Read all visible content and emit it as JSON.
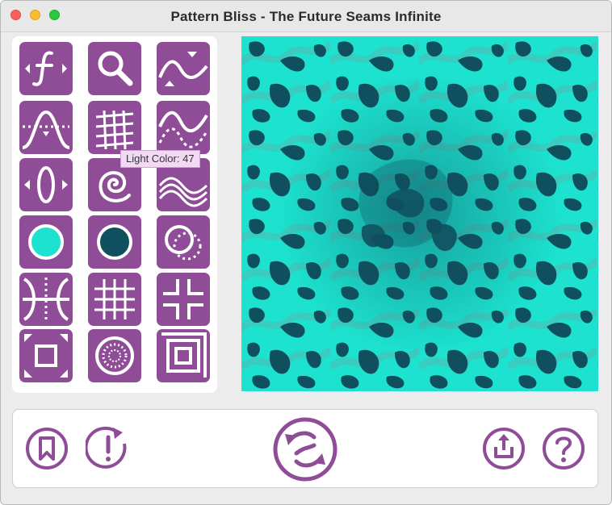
{
  "window": {
    "title": "Pattern Bliss - The Future Seams Infinite"
  },
  "tooltip": {
    "text": "Light Color: 47"
  },
  "colors": {
    "tool_background": "#8f4d98",
    "tool_foreground": "#ffffff",
    "light_color": "#1de2cf",
    "dark_color": "#0f4f5e",
    "tooltip_background": "#f3d9f4"
  },
  "tools": [
    {
      "icon": "function-icon"
    },
    {
      "icon": "magnifier-icon"
    },
    {
      "icon": "wave-arrows-icon"
    },
    {
      "icon": "bell-curve-icon"
    },
    {
      "icon": "grid-distort-icon"
    },
    {
      "icon": "wave-dashed-icon"
    },
    {
      "icon": "lens-arrows-icon"
    },
    {
      "icon": "spiral-icon"
    },
    {
      "icon": "wave-bands-icon"
    },
    {
      "icon": "light-color-icon"
    },
    {
      "icon": "dark-color-icon"
    },
    {
      "icon": "circles-overlap-icon"
    },
    {
      "icon": "mirror-axis-icon"
    },
    {
      "icon": "grid-icon"
    },
    {
      "icon": "cross-corners-icon"
    },
    {
      "icon": "expand-frame-icon"
    },
    {
      "icon": "radial-dots-icon"
    },
    {
      "icon": "concentric-squares-icon"
    }
  ],
  "bottom_bar": {
    "buttons": [
      {
        "icon": "bookmark-icon"
      },
      {
        "icon": "revert-icon"
      },
      {
        "icon": "shuffle-icon"
      },
      {
        "icon": "share-icon"
      },
      {
        "icon": "help-icon"
      }
    ]
  }
}
